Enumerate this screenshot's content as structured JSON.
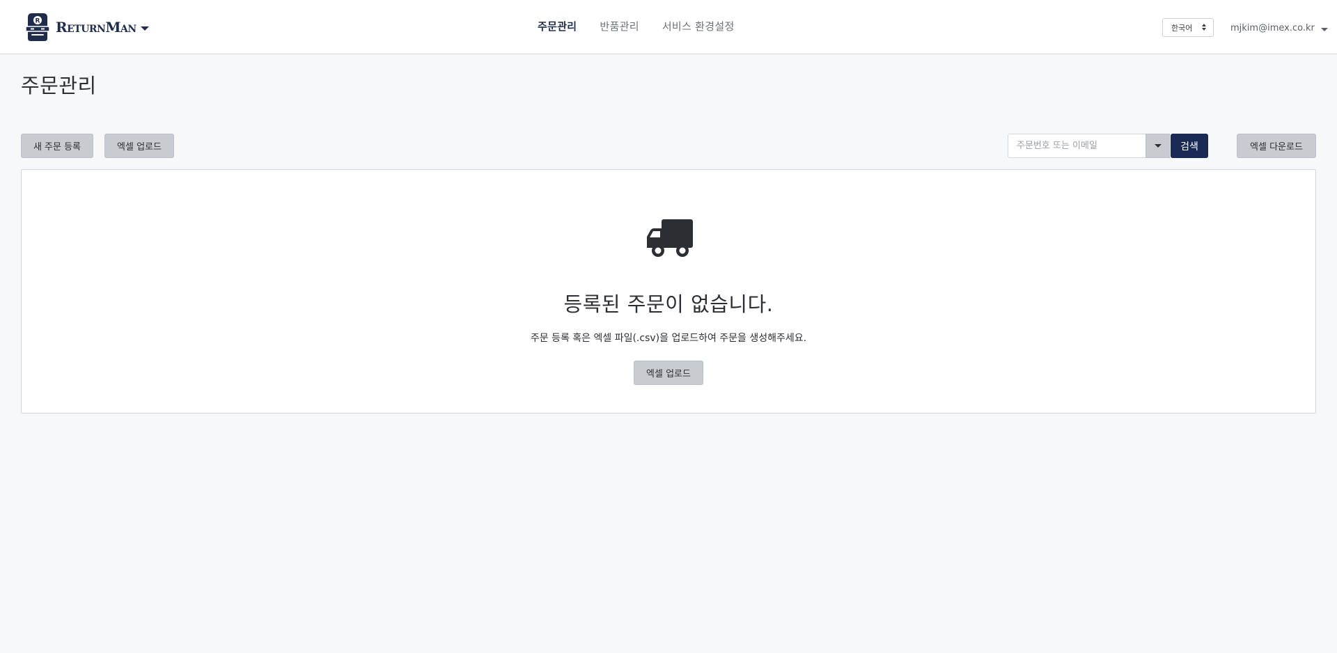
{
  "header": {
    "brand_name": "ReturnMan",
    "logo_letter": "R",
    "nav": [
      {
        "label": "주문관리",
        "active": true
      },
      {
        "label": "반품관리",
        "active": false
      },
      {
        "label": "서비스 환경설정",
        "active": false
      }
    ],
    "language": "한국어",
    "user_email": "mjkim@imex.co.kr"
  },
  "page": {
    "title": "주문관리"
  },
  "toolbar": {
    "new_order_label": "새 주문 등록",
    "excel_upload_label": "엑셀 업로드",
    "search_placeholder": "주문번호 또는 이메일",
    "search_value": "",
    "search_button_label": "검색",
    "excel_download_label": "엑셀 다운로드"
  },
  "empty_state": {
    "icon": "truck-icon",
    "title": "등록된 주문이 없습니다.",
    "description": "주문 등록 혹은 엑셀 파일(.csv)을 업로드하여 주문을 생성해주세요.",
    "upload_button_label": "엑셀 업로드"
  },
  "colors": {
    "brand_navy": "#1b2a55",
    "background": "#f7f8f9",
    "button_gray": "#c8ccd1"
  }
}
